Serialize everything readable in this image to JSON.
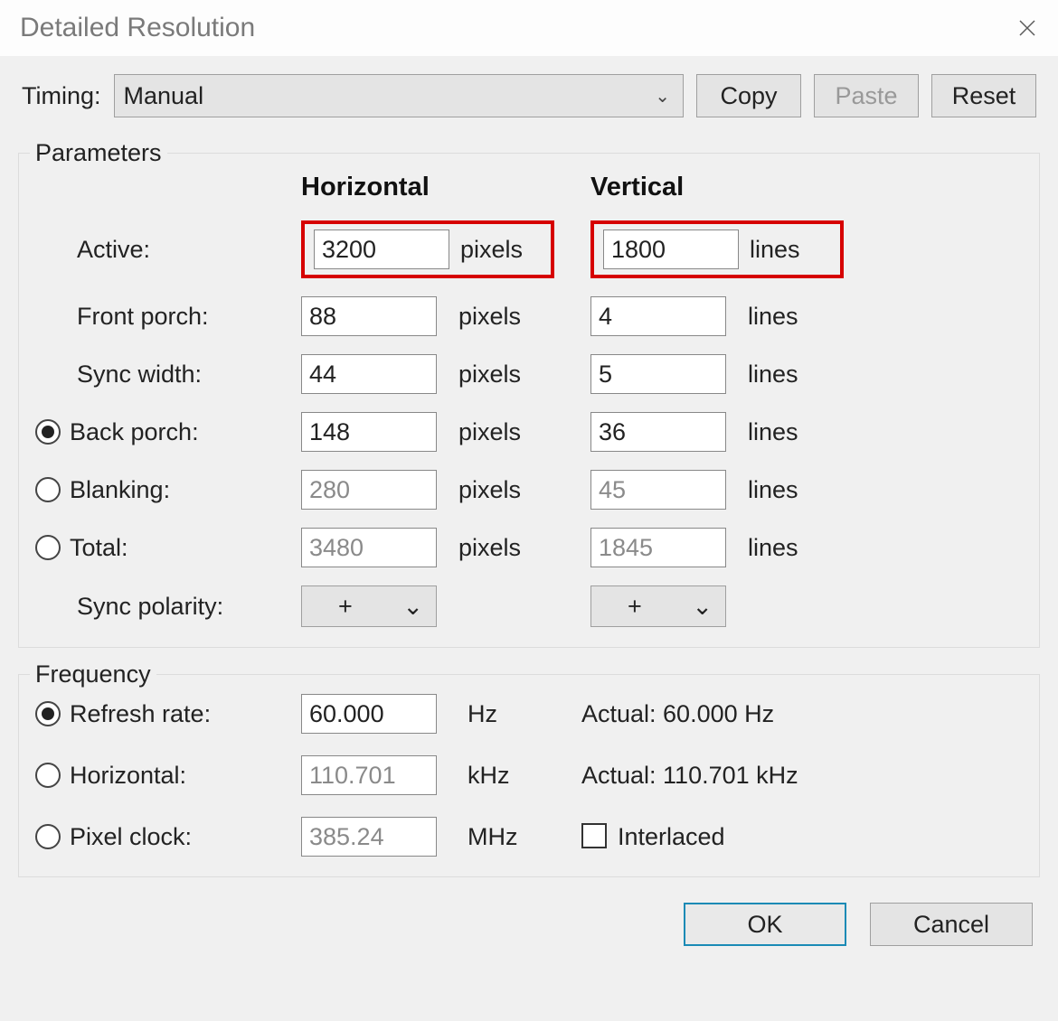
{
  "title": "Detailed Resolution",
  "toolbar": {
    "timing_label": "Timing:",
    "timing_value": "Manual",
    "copy": "Copy",
    "paste": "Paste",
    "reset": "Reset"
  },
  "groups": {
    "parameters": "Parameters",
    "frequency": "Frequency"
  },
  "headers": {
    "horizontal": "Horizontal",
    "vertical": "Vertical"
  },
  "units": {
    "pixels": "pixels",
    "lines": "lines",
    "hz": "Hz",
    "khz": "kHz",
    "mhz": "MHz"
  },
  "rows": {
    "active": {
      "label": "Active:",
      "h": "3200",
      "v": "1800"
    },
    "front_porch": {
      "label": "Front porch:",
      "h": "88",
      "v": "4"
    },
    "sync_width": {
      "label": "Sync width:",
      "h": "44",
      "v": "5"
    },
    "back_porch": {
      "label": "Back porch:",
      "h": "148",
      "v": "36",
      "selected": true
    },
    "blanking": {
      "label": "Blanking:",
      "h": "280",
      "v": "45",
      "readonly": true
    },
    "total": {
      "label": "Total:",
      "h": "3480",
      "v": "1845",
      "readonly": true
    },
    "sync_polarity": {
      "label": "Sync polarity:",
      "h": "+",
      "v": "+"
    }
  },
  "frequency": {
    "refresh": {
      "label": "Refresh rate:",
      "value": "60.000",
      "actual": "Actual: 60.000 Hz",
      "selected": true
    },
    "horizontal": {
      "label": "Horizontal:",
      "value": "110.701",
      "actual": "Actual: 110.701 kHz",
      "readonly": true
    },
    "pixel_clock": {
      "label": "Pixel clock:",
      "value": "385.24",
      "readonly": true
    },
    "interlaced_label": "Interlaced"
  },
  "buttons": {
    "ok": "OK",
    "cancel": "Cancel"
  }
}
